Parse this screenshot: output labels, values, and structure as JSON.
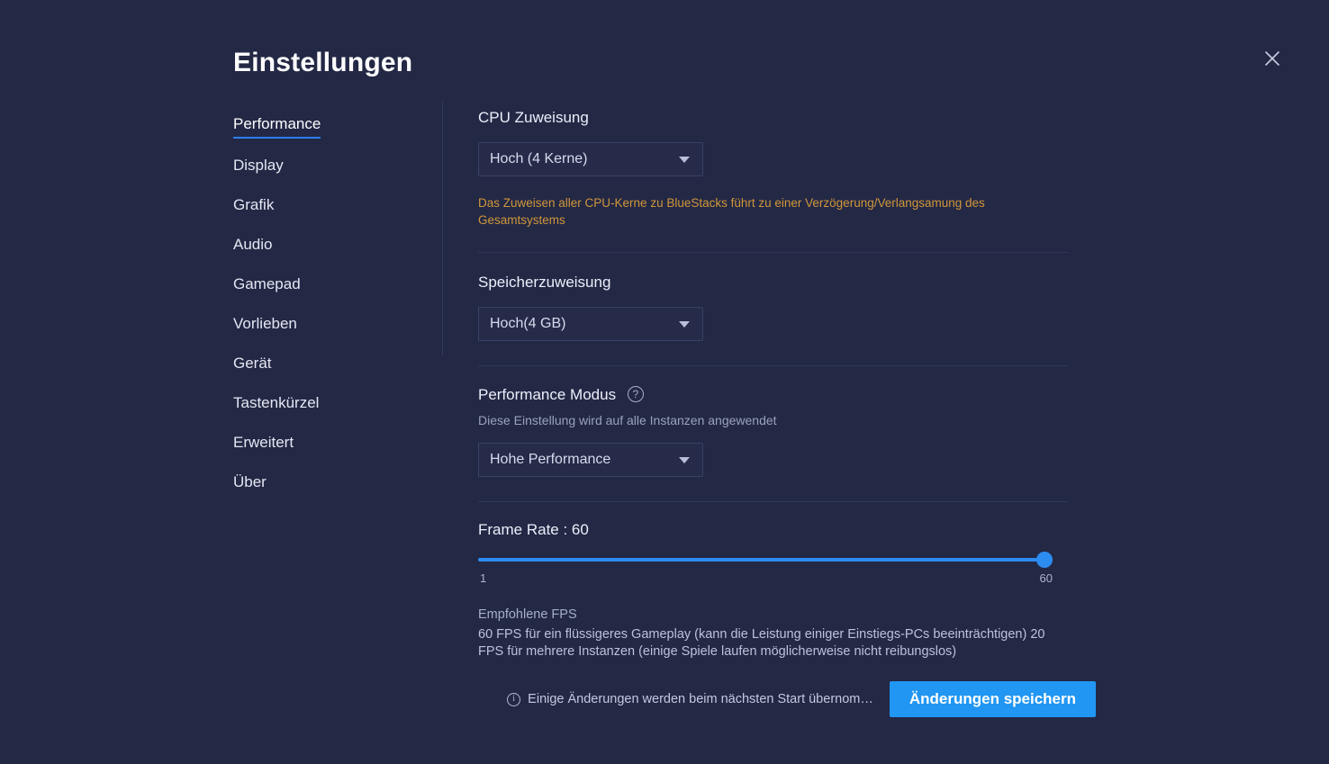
{
  "window": {
    "title": "Einstellungen",
    "close_icon": "close-icon"
  },
  "sidebar": {
    "items": [
      {
        "label": "Performance",
        "active": true
      },
      {
        "label": "Display",
        "active": false
      },
      {
        "label": "Grafik",
        "active": false
      },
      {
        "label": "Audio",
        "active": false
      },
      {
        "label": "Gamepad",
        "active": false
      },
      {
        "label": "Vorlieben",
        "active": false
      },
      {
        "label": "Gerät",
        "active": false
      },
      {
        "label": "Tastenkürzel",
        "active": false
      },
      {
        "label": "Erweitert",
        "active": false
      },
      {
        "label": "Über",
        "active": false
      }
    ]
  },
  "cpu": {
    "label": "CPU Zuweisung",
    "value": "Hoch (4 Kerne)",
    "warning": "Das Zuweisen aller CPU-Kerne zu BlueStacks  führt zu einer Verzögerung/Verlangsamung des Gesamtsystems"
  },
  "memory": {
    "label": "Speicherzuweisung",
    "value": "Hoch(4 GB)"
  },
  "performance_mode": {
    "label": "Performance Modus",
    "help_icon": "?",
    "description": "Diese Einstellung wird auf alle Instanzen angewendet",
    "value": "Hohe Performance"
  },
  "frame_rate": {
    "label": "Frame Rate : 60",
    "value": 60,
    "min": 1,
    "max": 60,
    "min_label": "1",
    "max_label": "60",
    "fps_title": "Empfohlene FPS",
    "fps_description": "60 FPS für ein flüssigeres Gameplay (kann die Leistung einiger Einstiegs-PCs beeinträchtigen) 20 FPS für mehrere Instanzen (einige Spiele laufen möglicherweise nicht reibungslos)"
  },
  "footer": {
    "note": "Einige Änderungen werden beim nächsten Start übernom…",
    "info_icon": "i",
    "save_label": "Änderungen speichern"
  },
  "colors": {
    "background": "#232845",
    "accent": "#2196f3",
    "warning": "#d1973a",
    "divider": "#30365a"
  }
}
